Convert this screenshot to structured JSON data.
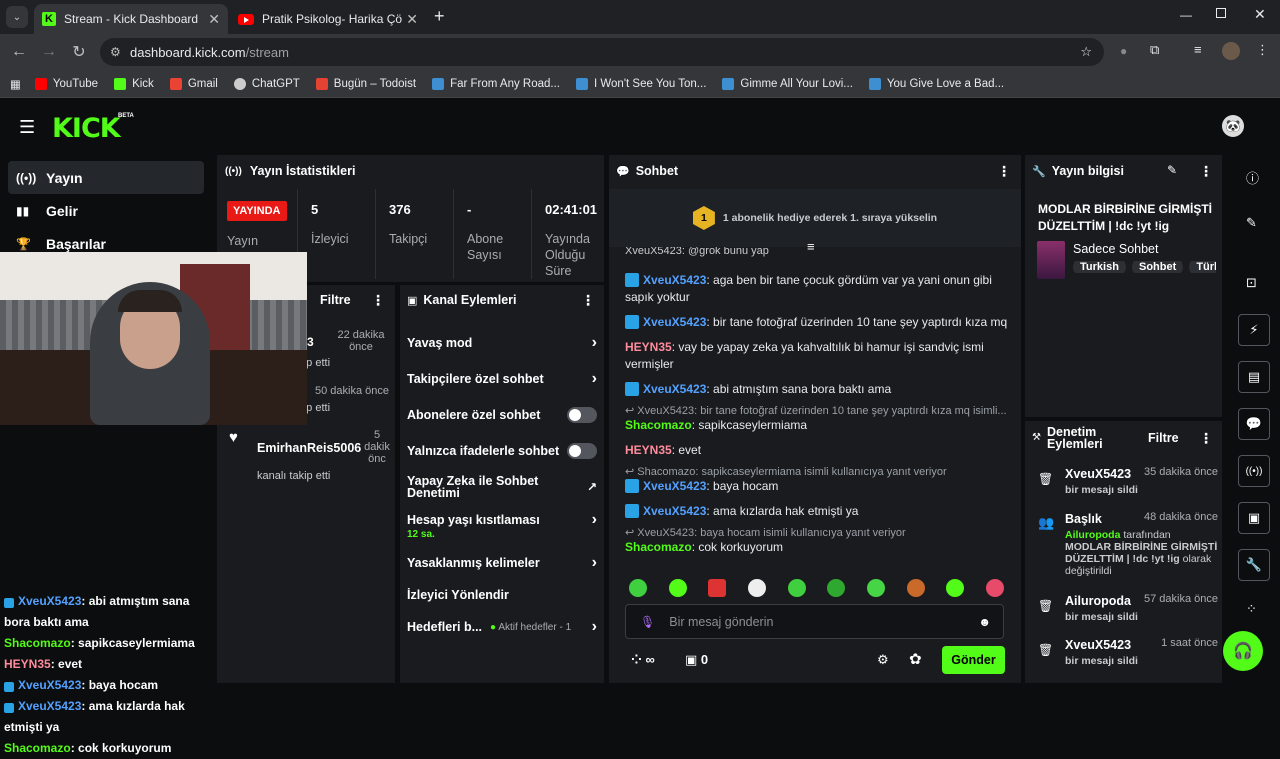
{
  "browser": {
    "tabs": [
      {
        "title": "Stream - Kick Dashboard"
      },
      {
        "title": "Pratik Psikolog- Harika Çözüm"
      }
    ],
    "new_tab": "+",
    "url_domain": "dashboard.kick.com",
    "url_path": "/stream",
    "bookmarks": [
      "YouTube",
      "Kick",
      "Gmail",
      "ChatGPT",
      "Bugün – Todoist",
      "Far From Any Road...",
      "I Won't See You Ton...",
      "Gimme All Your Lovi...",
      "You Give Love a Bad..."
    ]
  },
  "kick": {
    "logo": "KICK",
    "beta": "BETA"
  },
  "sidebar": {
    "items": [
      {
        "label": "Yayın",
        "icon": "broadcast-icon"
      },
      {
        "label": "Gelir",
        "icon": "chart-icon"
      },
      {
        "label": "Başarılar",
        "icon": "trophy-icon"
      }
    ]
  },
  "stats": {
    "title": "Yayın İstatistikleri",
    "live": "YAYINDA",
    "live_label": "Yayın",
    "items": [
      {
        "value": "5",
        "label": "İzleyici"
      },
      {
        "value": "376",
        "label": "Takipçi"
      },
      {
        "value": "-",
        "label": "Abone Sayısı"
      },
      {
        "value": "02:41:01",
        "label": "Yayında Olduğu Süre"
      }
    ]
  },
  "activity": {
    "filter": "Filtre",
    "items": [
      {
        "name": "...3",
        "time": "22 dakika önce",
        "desc": "...p etti"
      },
      {
        "name": "",
        "time": "50 dakika önce",
        "desc": "...p etti"
      },
      {
        "name": "EmirhanReis5006",
        "time": "5 dakik önc",
        "desc": "kanalı takip etti"
      }
    ]
  },
  "channel_actions": {
    "title": "Kanal Eylemleri",
    "items": [
      {
        "label": "Yavaş mod"
      },
      {
        "label": "Takipçilere özel sohbet"
      },
      {
        "label": "Abonelere özel sohbet"
      },
      {
        "label": "Yalnızca ifadelerle sohbet"
      },
      {
        "label": "Yapay Zeka ile Sohbet Denetimi"
      },
      {
        "label": "Hesap yaşı kısıtlaması",
        "sub": "12 sa."
      },
      {
        "label": "Yasaklanmış kelimeler"
      },
      {
        "label": "İzleyici Yönlendir"
      },
      {
        "label": "Hedefleri b...",
        "sub": "Aktif hedefler - 1"
      }
    ]
  },
  "chat": {
    "title": "Sohbet",
    "promo_rank": "1",
    "promo": "1 abonelik hediye ederek 1. sıraya yükselin",
    "top_cut": "XveuX5423: @grok bunu yap",
    "messages": [
      {
        "user": "XveuX5423",
        "text": ": aga ben bir tane çocuk gördüm var ya yani onun gibi sapık yoktur",
        "badge": true,
        "color": "blue"
      },
      {
        "user": "XveuX5423",
        "text": ": bir tane fotoğraf üzerinden 10 tane şey yaptırdı kıza mq",
        "badge": true,
        "color": "blue"
      },
      {
        "user": "HEYN35",
        "text": ": vay be yapay zeka ya kahvaltılık bi hamur işi sandviç ismi vermişler",
        "badge": false,
        "color": "pink"
      },
      {
        "user": "XveuX5423",
        "text": ": abi atmıştım sana bora baktı ama",
        "badge": true,
        "color": "blue"
      },
      {
        "reply": "XveuX5423: bir tane fotoğraf üzerinden 10 tane şey yaptırdı kıza mq isimli...",
        "user": "Shacomazo",
        "text": ": sapikcaseylermiama",
        "badge": false,
        "color": "green"
      },
      {
        "user": "HEYN35",
        "text": ": evet",
        "badge": false,
        "color": "pink"
      },
      {
        "reply": "Shacomazo: sapikcaseylermiama isimli kullanıcıya yanıt veriyor",
        "user": "XveuX5423",
        "text": ": baya hocam",
        "badge": true,
        "color": "blue"
      },
      {
        "user": "XveuX5423",
        "text": ": ama kızlarda hak etmişti ya",
        "badge": true,
        "color": "blue"
      },
      {
        "reply": "XveuX5423: baya hocam isimli kullanıcıya yanıt veriyor",
        "user": "Shacomazo",
        "text": ": cok korkuyorum",
        "badge": false,
        "color": "green"
      }
    ],
    "input_placeholder": "Bir mesaj gönderin",
    "points": "∞",
    "gifts": "0",
    "send": "Gönder"
  },
  "overlay_chat": [
    {
      "user": "XveuX5423",
      "text": ": abi atmıştım sana bora baktı ama",
      "color": "blue",
      "badge": true
    },
    {
      "user": "Shacomazo",
      "text": ": sapikcaseylermiama",
      "color": "green",
      "badge": false
    },
    {
      "user": "HEYN35",
      "text": ": evet",
      "color": "pink",
      "badge": false
    },
    {
      "user": "XveuX5423",
      "text": ": baya hocam",
      "color": "blue",
      "badge": true
    },
    {
      "user": "XveuX5423",
      "text": ": ama kızlarda hak etmişti ya",
      "color": "blue",
      "badge": true
    },
    {
      "user": "Shacomazo",
      "text": ": cok korkuyorum",
      "color": "green",
      "badge": false
    }
  ],
  "stream_info": {
    "title": "Yayın bilgisi",
    "stream_title": "MODLAR BİRBİRİNE GİRMİŞTİ DÜZELTTİM | !dc !yt !ig",
    "category": "Sadece Sohbet",
    "tags": [
      "Turkish",
      "Sohbet",
      "Türk"
    ]
  },
  "mod": {
    "title": "Denetim Eylemleri",
    "filter": "Filtre",
    "items": [
      {
        "user": "XveuX5423",
        "time": "35 dakika önce",
        "desc": "bir mesajı sildi"
      },
      {
        "user": "Başlık",
        "time": "48 dakika önce",
        "by": "Ailuropoda",
        "by_suffix": " tarafından",
        "new_title": "MODLAR BİRBİRİNE GİRMİŞTİ DÜZELTTİM | !dc !yt !ig",
        "tail": " olarak değiştirildi"
      },
      {
        "user": "Ailuropoda",
        "time": "57 dakika önce",
        "desc": "bir mesajı sildi"
      },
      {
        "user": "XveuX5423",
        "time": "1 saat önce",
        "desc": "bir mesajı sildi"
      }
    ]
  },
  "colors": {
    "accent": "#53fc18",
    "live": "#e91916",
    "panel": "#191b1f",
    "bg": "#0b0d0e"
  }
}
